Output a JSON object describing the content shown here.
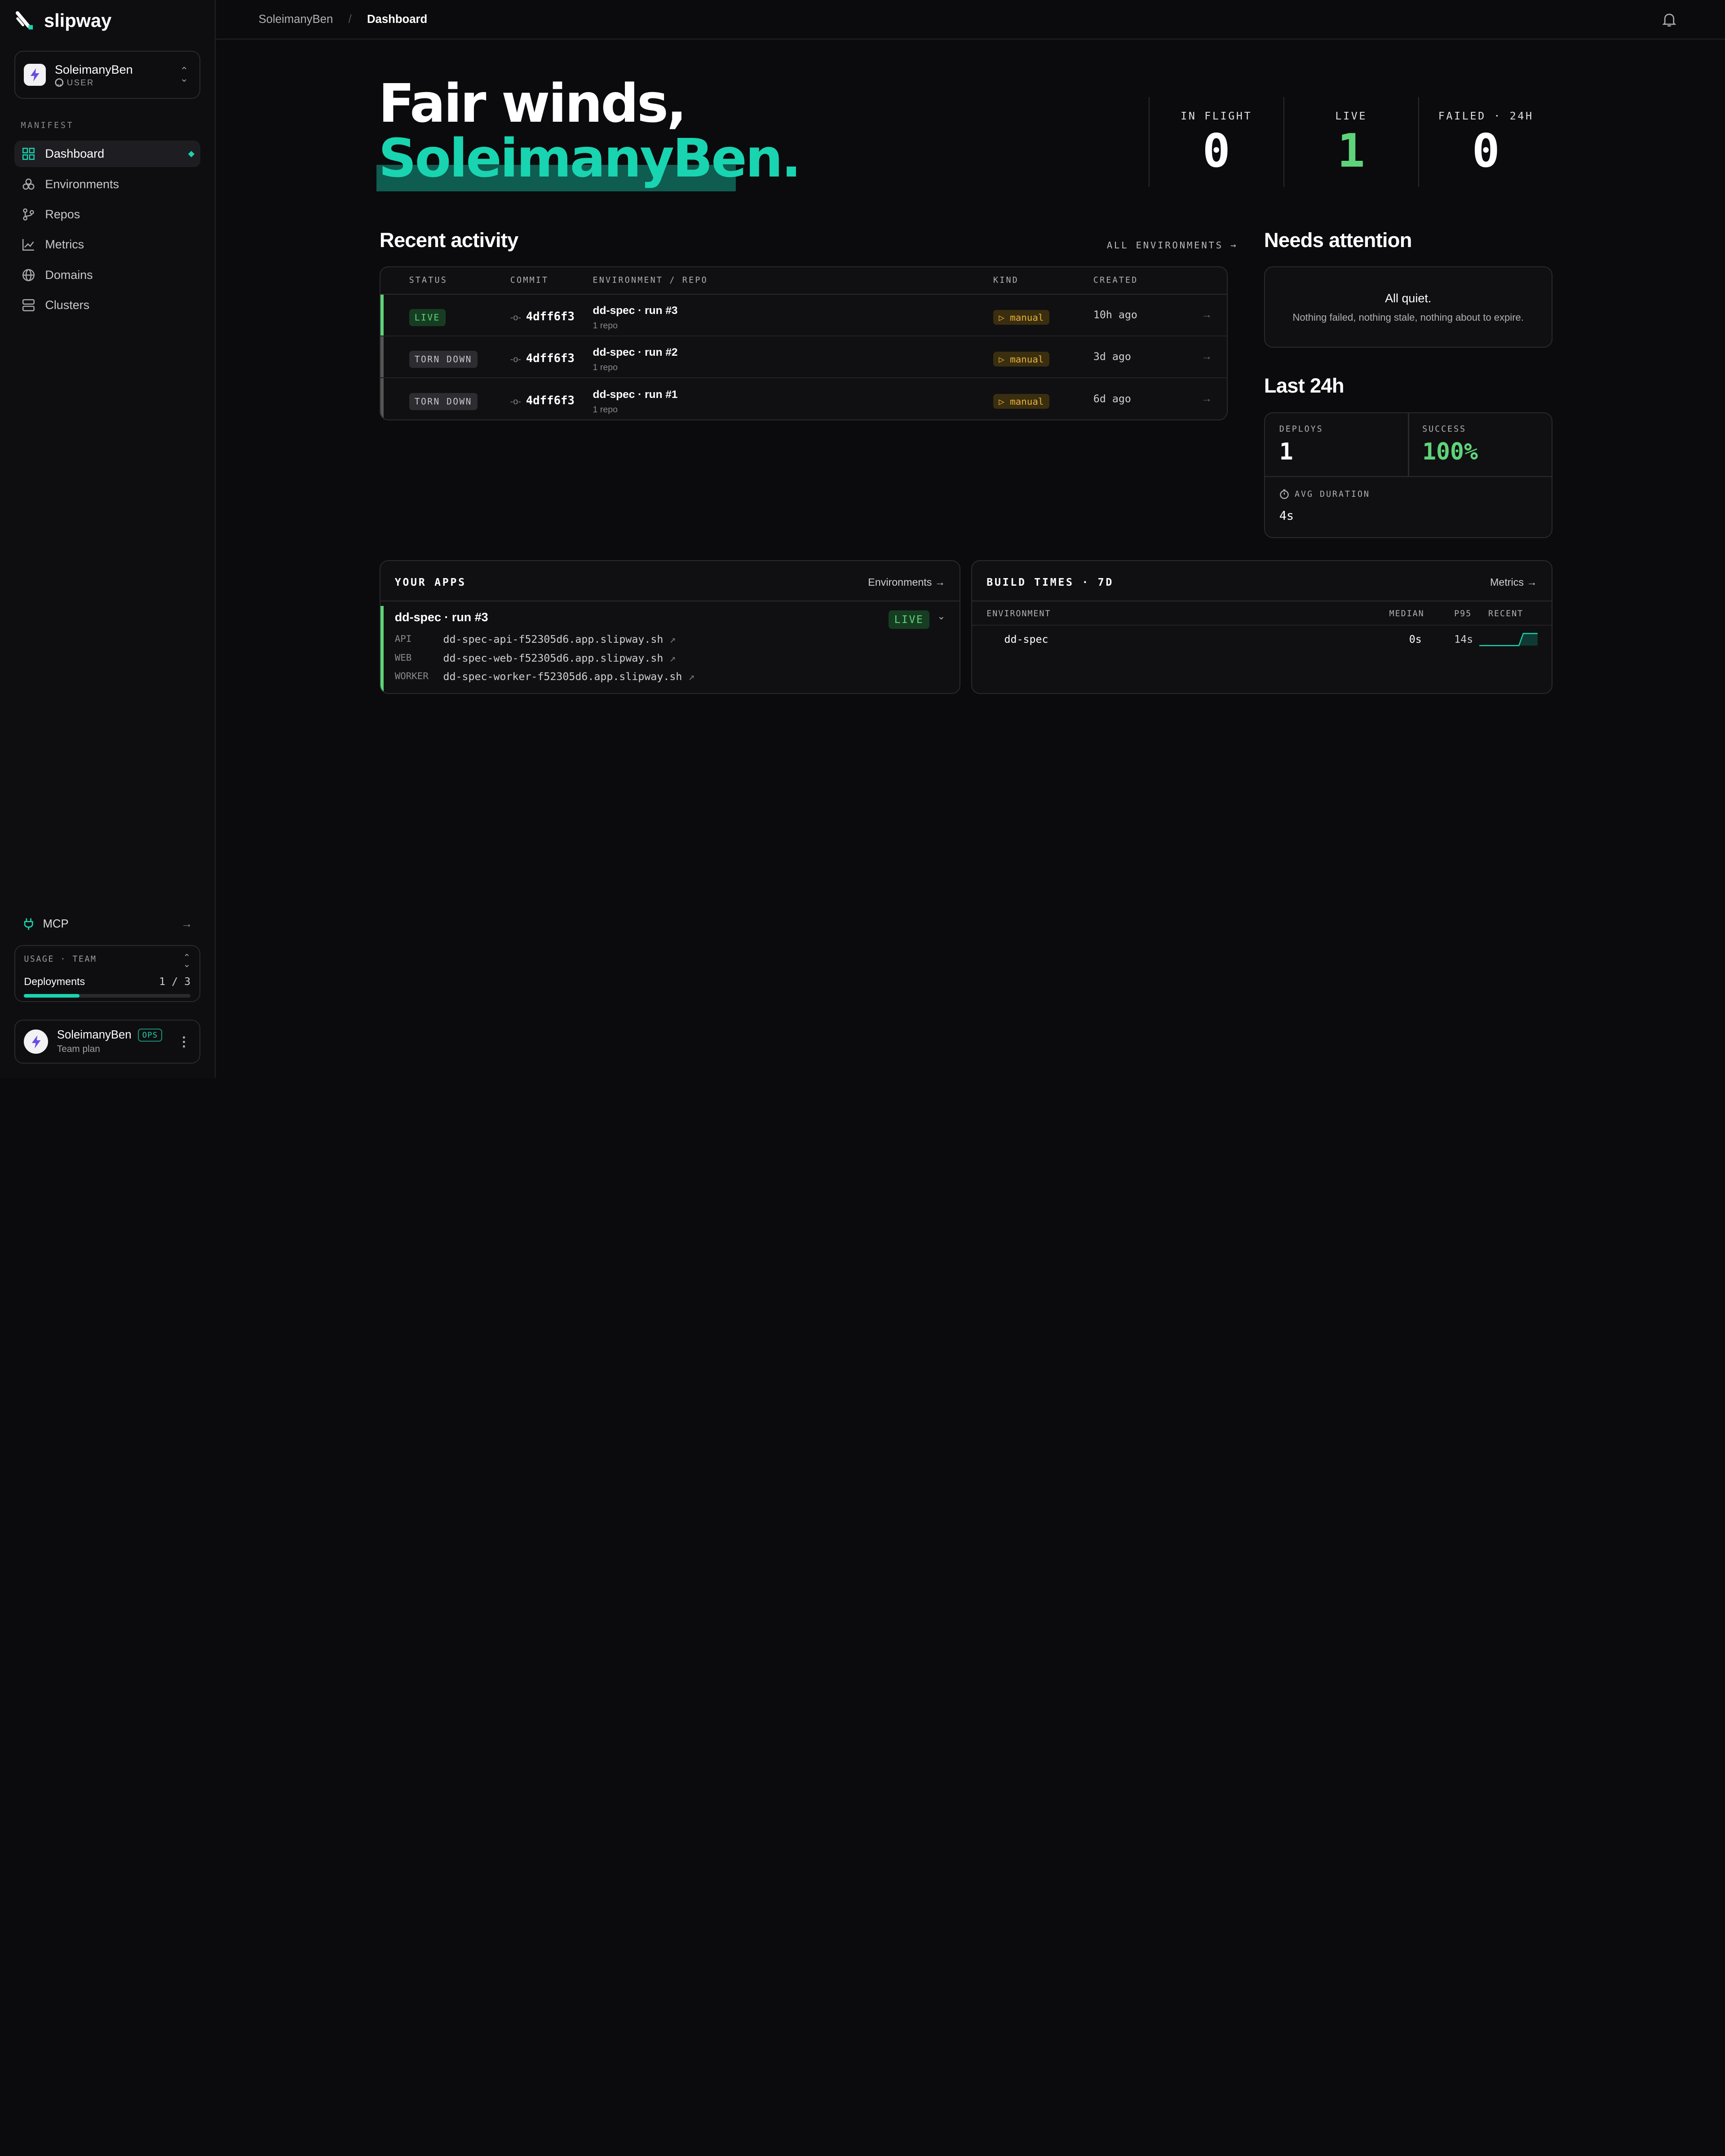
{
  "brand": {
    "name": "slipway"
  },
  "workspace": {
    "name": "SoleimanyBen",
    "type": "USER"
  },
  "nav": {
    "section_label": "MANIFEST",
    "items": [
      {
        "label": "Dashboard",
        "active": true
      },
      {
        "label": "Environments"
      },
      {
        "label": "Repos"
      },
      {
        "label": "Metrics"
      },
      {
        "label": "Domains"
      },
      {
        "label": "Clusters"
      }
    ]
  },
  "mcp": {
    "label": "MCP"
  },
  "usage": {
    "label": "USAGE · TEAM",
    "metric": "Deployments",
    "count": "1 / 3",
    "fraction": 0.333
  },
  "user": {
    "name": "SoleimanyBen",
    "badge": "OPS",
    "plan": "Team plan"
  },
  "breadcrumb": {
    "parent": "SoleimanyBen",
    "sep": "/",
    "current": "Dashboard"
  },
  "hero": {
    "line1": "Fair winds,",
    "line2": "SoleimanyBen."
  },
  "stats": [
    {
      "label": "IN FLIGHT",
      "value": "0",
      "color": "#ffffff"
    },
    {
      "label": "LIVE",
      "value": "1",
      "color": "#5fd37a"
    },
    {
      "label": "FAILED · 24H",
      "value": "0",
      "color": "#ffffff"
    }
  ],
  "activity": {
    "title": "Recent activity",
    "link": "ALL ENVIRONMENTS",
    "columns": {
      "status": "STATUS",
      "commit": "COMMIT",
      "env": "ENVIRONMENT / REPO",
      "kind": "KIND",
      "created": "CREATED"
    },
    "rows": [
      {
        "status": "LIVE",
        "commit": "4dff6f3",
        "env": "dd-spec · run #3",
        "repos": "1 repo",
        "kind": "manual",
        "created": "10h ago"
      },
      {
        "status": "TORN DOWN",
        "commit": "4dff6f3",
        "env": "dd-spec · run #2",
        "repos": "1 repo",
        "kind": "manual",
        "created": "3d ago"
      },
      {
        "status": "TORN DOWN",
        "commit": "4dff6f3",
        "env": "dd-spec · run #1",
        "repos": "1 repo",
        "kind": "manual",
        "created": "6d ago"
      }
    ]
  },
  "attention": {
    "title": "Needs attention",
    "headline": "All quiet.",
    "sub": "Nothing failed, nothing stale, nothing about to expire."
  },
  "last24": {
    "title": "Last 24h",
    "deploys_label": "DEPLOYS",
    "deploys": "1",
    "success_label": "SUCCESS",
    "success": "100%",
    "avg_label": "AVG DURATION",
    "avg": "4s"
  },
  "apps": {
    "title": "YOUR APPS",
    "link": "Environments",
    "app_name": "dd-spec · run #3",
    "status": "LIVE",
    "services": [
      {
        "kind": "API",
        "url": "dd-spec-api-f52305d6.app.slipway.sh"
      },
      {
        "kind": "WEB",
        "url": "dd-spec-web-f52305d6.app.slipway.sh"
      },
      {
        "kind": "WORKER",
        "url": "dd-spec-worker-f52305d6.app.slipway.sh"
      }
    ]
  },
  "builds": {
    "title": "BUILD TIMES · 7D",
    "link": "Metrics",
    "columns": {
      "env": "ENVIRONMENT",
      "median": "MEDIAN",
      "p95": "P95",
      "recent": "RECENT"
    },
    "rows": [
      {
        "env": "dd-spec",
        "median": "0s",
        "p95": "14s"
      }
    ]
  },
  "colors": {
    "accent": "#19d4b0",
    "live": "#5fd37a",
    "manual": "#e8b23a"
  }
}
